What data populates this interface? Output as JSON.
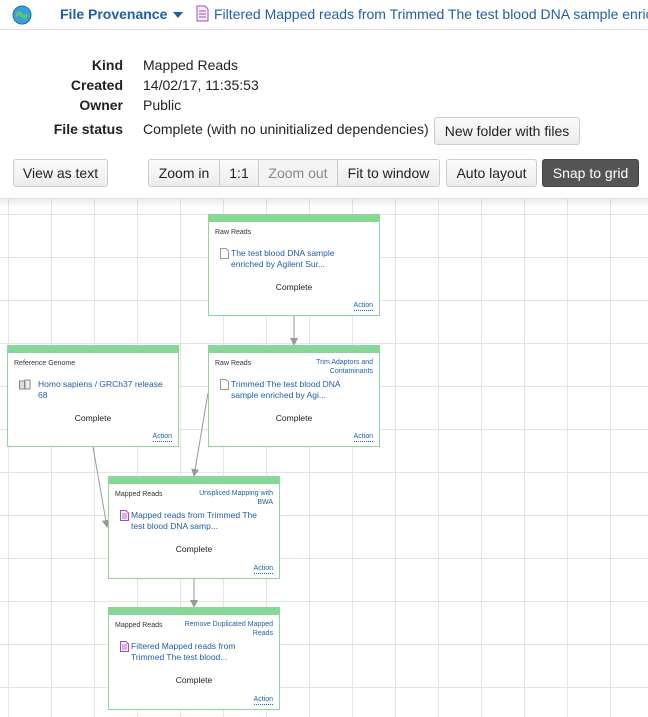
{
  "header": {
    "menu_title": "File Provenance",
    "file_title": "Filtered Mapped reads from Trimmed The test blood DNA sample enriched"
  },
  "details": {
    "kind_label": "Kind",
    "kind_value": "Mapped Reads",
    "created_label": "Created",
    "created_value": "14/02/17, 11:35:53",
    "owner_label": "Owner",
    "owner_value": "Public",
    "status_label": "File status",
    "status_value": "Complete (with no uninitialized dependencies)",
    "new_folder_label": "New folder with files"
  },
  "toolbar": {
    "view_as_text": "View as text",
    "zoom_in": "Zoom in",
    "one_to_one": "1:1",
    "zoom_out": "Zoom out",
    "fit_to_window": "Fit to window",
    "auto_layout": "Auto layout",
    "snap_to_grid": "Snap to grid"
  },
  "nodes": [
    {
      "kind": "Raw Reads",
      "job": "",
      "file": "The test blood DNA sample enriched by Agilent Sur...",
      "status": "Complete",
      "action": "Action",
      "icon": "file-icon"
    },
    {
      "kind": "Reference Genome",
      "job": "",
      "file": "Homo sapiens / GRCh37 release 68",
      "status": "Complete",
      "action": "Action",
      "icon": "genome-icon"
    },
    {
      "kind": "Raw Reads",
      "job": "Trim Adaptors and Contaminants",
      "file": "Trimmed The test blood DNA sample enriched by Agi...",
      "status": "Complete",
      "action": "Action",
      "icon": "file-icon"
    },
    {
      "kind": "Mapped Reads",
      "job": "Unspliced Mapping with BWA",
      "file": "Mapped reads from Trimmed The test blood DNA samp...",
      "status": "Complete",
      "action": "Action",
      "icon": "mapped-file-icon"
    },
    {
      "kind": "Mapped Reads",
      "job": "Remove Duplicated Mapped Reads",
      "file": "Filtered Mapped reads from Trimmed The test blood...",
      "status": "Complete",
      "action": "Action",
      "icon": "mapped-file-icon"
    }
  ],
  "colors": {
    "link": "#1f5fa8",
    "node_bar": "#86d896",
    "snap_button": "#555555"
  }
}
